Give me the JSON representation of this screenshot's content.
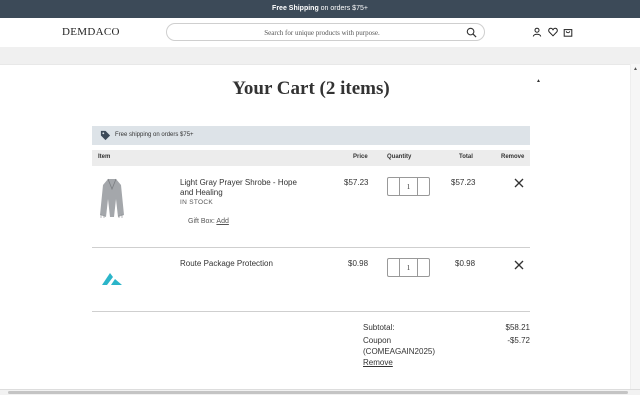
{
  "promo": {
    "bold": "Free Shipping",
    "rest": " on orders $75+"
  },
  "header": {
    "logo": "DEMDACO",
    "search_placeholder": "Search for unique products with purpose."
  },
  "page": {
    "title": "Your Cart (2 items)"
  },
  "banner": {
    "text": "Free shipping on orders $75+"
  },
  "table": {
    "headers": {
      "item": "Item",
      "price": "Price",
      "quantity": "Quantity",
      "total": "Total",
      "remove": "Remove"
    }
  },
  "items": [
    {
      "name": "Light Gray Prayer Shrobe - Hope and Healing",
      "stock": "IN STOCK",
      "gift_label": "Gift Box:",
      "gift_link": "Add",
      "price": "$57.23",
      "qty": "1",
      "total": "$57.23"
    },
    {
      "name": "Route Package Protection",
      "price": "$0.98",
      "qty": "1",
      "total": "$0.98"
    }
  ],
  "summary": {
    "subtotal_label": "Subtotal:",
    "subtotal_value": "$58.21",
    "coupon_label": "Coupon",
    "coupon_code": "(COMEAGAIN2025)",
    "coupon_value": "-$5.72",
    "remove_link": "Remove"
  },
  "colors": {
    "promo_bg": "#3c4a58",
    "banner_bg": "#dde3e8",
    "route_accent": "#2bb5c9"
  }
}
